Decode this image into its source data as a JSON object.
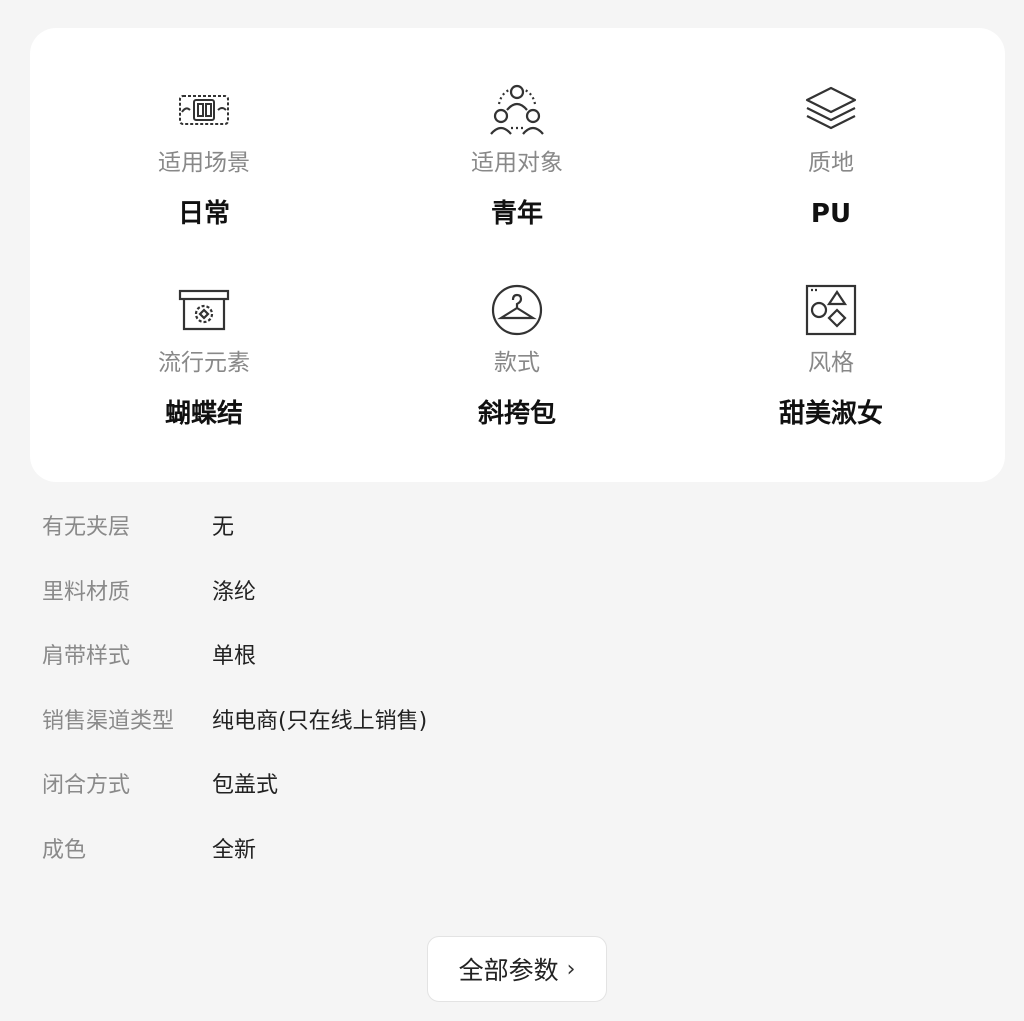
{
  "attributes": [
    {
      "label": "适用场景",
      "value": "日常",
      "icon": "scene-icon"
    },
    {
      "label": "适用对象",
      "value": "青年",
      "icon": "people-icon"
    },
    {
      "label": "质地",
      "value": "PU",
      "icon": "layers-icon"
    },
    {
      "label": "流行元素",
      "value": "蝴蝶结",
      "icon": "box-icon"
    },
    {
      "label": "款式",
      "value": "斜挎包",
      "icon": "hanger-icon"
    },
    {
      "label": "风格",
      "value": "甜美淑女",
      "icon": "shapes-icon"
    }
  ],
  "params": [
    {
      "key": "有无夹层",
      "value": "无"
    },
    {
      "key": "里料材质",
      "value": "涤纶"
    },
    {
      "key": "肩带样式",
      "value": "单根"
    },
    {
      "key": "销售渠道类型",
      "value": "纯电商(只在线上销售)"
    },
    {
      "key": "闭合方式",
      "value": "包盖式"
    },
    {
      "key": "成色",
      "value": "全新"
    }
  ],
  "all_params_button": {
    "label": "全部参数",
    "chevron": "›"
  }
}
